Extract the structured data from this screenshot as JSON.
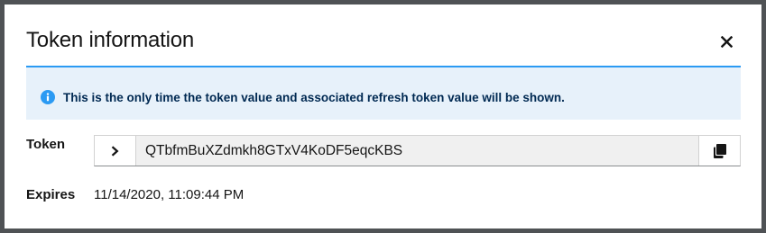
{
  "modal": {
    "title": "Token information",
    "close_icon": "close-icon"
  },
  "alert": {
    "icon": "info-circle-icon",
    "message": "This is the only time the token value and associated refresh token value will be shown.",
    "color": "#2b9af3"
  },
  "token": {
    "label": "Token",
    "value": "QTbfmBuXZdmkh8GTxV4KoDF5eqcKBS",
    "expand_icon": "chevron-right-icon",
    "copy_icon": "copy-icon"
  },
  "expires": {
    "label": "Expires",
    "value": "11/14/2020, 11:09:44 PM"
  }
}
